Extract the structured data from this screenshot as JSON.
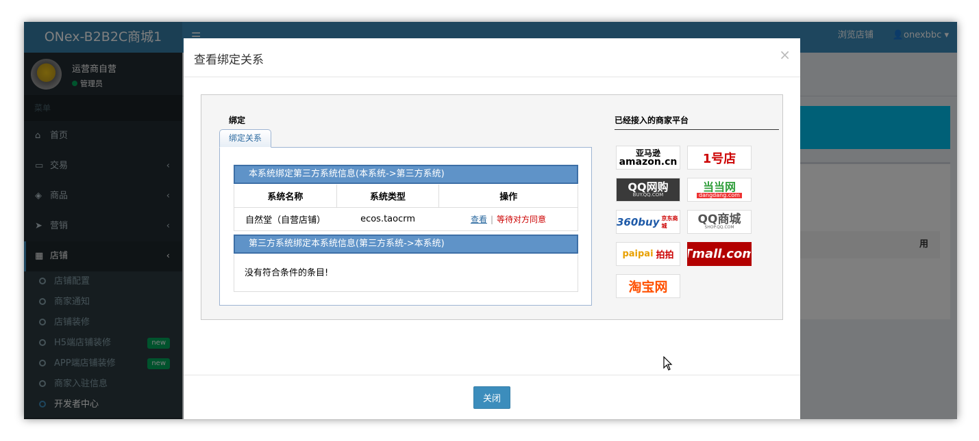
{
  "header": {
    "app_title": "ONex-B2B2C商城1",
    "browse_store": "浏览店铺",
    "username": "onexbbc"
  },
  "sidebar": {
    "user_name": "运营商自营",
    "user_role": "管理员",
    "menu_header": "菜单",
    "items": [
      {
        "label": "首页",
        "icon": "home-icon"
      },
      {
        "label": "交易",
        "icon": "credit-card-icon"
      },
      {
        "label": "商品",
        "icon": "cube-icon"
      },
      {
        "label": "营销",
        "icon": "tags-icon"
      },
      {
        "label": "店铺",
        "icon": "building-icon"
      }
    ],
    "subitems": [
      {
        "label": "店铺配置"
      },
      {
        "label": "商家通知"
      },
      {
        "label": "店铺装修"
      },
      {
        "label": "H5端店铺装修",
        "badge": "new"
      },
      {
        "label": "APP端店铺装修",
        "badge": "new"
      },
      {
        "label": "商家入驻信息"
      },
      {
        "label": "开发者中心"
      }
    ]
  },
  "background": {
    "table_header_partial": "用"
  },
  "modal": {
    "title": "查看绑定关系",
    "close_symbol": "×",
    "bind_title": "绑定",
    "tab_label": "绑定关系",
    "section1_title": "本系统绑定第三方系统信息(本系统->第三方系统)",
    "columns": [
      "系统名称",
      "系统类型",
      "操作"
    ],
    "rows": [
      {
        "name": "自然堂（自营店铺）",
        "type": "ecos.taocrm",
        "action_view": "查看",
        "action_sep": "|",
        "action_status": "等待对方同意"
      }
    ],
    "section2_title": "第三方系统绑定本系统信息(第三方系统->本系统)",
    "empty_text": "没有符合条件的条目!",
    "platforms_title": "已经接入的商家平台",
    "platforms": [
      {
        "name": "亚马逊 amazon.cn",
        "line1": "亚马逊",
        "line2": "amazon.cn"
      },
      {
        "name": "1号店",
        "line1": "1号店"
      },
      {
        "name": "QQ网购",
        "line1": "QQ网购",
        "line2": "BUY.QQ.COM"
      },
      {
        "name": "当当网",
        "line1": "当当网",
        "line2": "dangdang.com"
      },
      {
        "name": "360buy 京东商城",
        "line1": "360buy",
        "line2": "京东商城"
      },
      {
        "name": "QQ商城",
        "line1": "QQ商城",
        "line2": "SHOP.QQ.COM"
      },
      {
        "name": "paipai 拍拍",
        "line1": "paipai",
        "line2": "拍拍"
      },
      {
        "name": "Tmall.com",
        "line1": "Tmall.com"
      },
      {
        "name": "淘宝网",
        "line1": "淘宝网"
      }
    ],
    "close_button": "关闭"
  },
  "colors": {
    "primary": "#3c8dbc",
    "sidebar": "#222d32",
    "pending": "#cc0000",
    "section_bar": "#5f93c8"
  }
}
